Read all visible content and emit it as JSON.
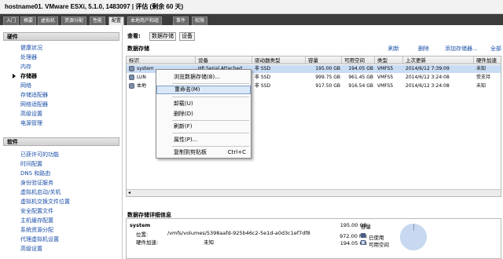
{
  "window": {
    "title": "hostname01. VMware ESXi, 5.1.0, 1483097 | 评估 (剩余 60 天)"
  },
  "tabs": [
    "入门",
    "摘要",
    "虚拟机",
    "资源分配",
    "性能",
    "配置",
    "本地用户和组",
    "事件",
    "权限"
  ],
  "active_tab_index": 5,
  "hardware": {
    "title": "硬件",
    "items": [
      "健康状况",
      "处理器",
      "内存",
      "存储器",
      "网络",
      "存储适配器",
      "网络适配器",
      "高级设置",
      "电源管理"
    ],
    "active_index": 3
  },
  "software": {
    "title": "软件",
    "items": [
      "已获许可的功能",
      "时间配置",
      "DNS 和路由",
      "身份验证服务",
      "虚拟机启动/关机",
      "虚拟机交换文件位置",
      "安全配置文件",
      "主机缓存配置",
      "系统资源分配",
      "代理虚拟机设置",
      "高级设置"
    ]
  },
  "view": {
    "label": "查看:",
    "buttons": [
      "数据存储",
      "设备"
    ]
  },
  "datastores": {
    "title": "数据存储",
    "actions": [
      "刷新",
      "删除",
      "添加存储器...",
      "全部"
    ],
    "columns": [
      "标识",
      "设备",
      "驱动器类型",
      "容量",
      "可用空间",
      "类型",
      "上次更新",
      "硬件加速"
    ],
    "rows": [
      [
        "system",
        "HP Serial Attached",
        "非 SSD",
        "195.00 GB",
        "194.05 GB",
        "VMFS5",
        "2014/6/12 7:39:09",
        "未知"
      ],
      [
        "LUN",
        "",
        "非 SSD",
        "999.75 GB",
        "961.45 GB",
        "VMFS5",
        "2014/6/12 3:24:08",
        "受支持"
      ],
      [
        "本地",
        "",
        "非 SSD",
        "917.50 GB",
        "916.54 GB",
        "VMFS5",
        "2014/6/12 3:24:08",
        "未知"
      ]
    ],
    "selected_row": 0
  },
  "context_menu": {
    "items": [
      "浏览数据存储(B)...",
      "重命名(M)",
      "卸载(U)",
      "删除(D)",
      "刷新(F)",
      "属性(P)...",
      "复制到剪贴板"
    ],
    "shortcut": "Ctrl+C",
    "highlighted_index": 1
  },
  "details": {
    "title": "数据存储详细信息",
    "name": "system",
    "location_label": "位置:",
    "location_value": "/vmfs/volumes/5398aafd-925b46c2-5e1d-a0d3c1ef7df8",
    "hw_accel_label": "硬件加速:",
    "hw_accel_value": "未知",
    "capacity": "195.00 GB",
    "capacity_label": "容量",
    "used": "972.00 MB",
    "used_label": "已使用",
    "free": "194.05 GB",
    "free_label": "可用空间",
    "used_fraction": 0.005
  },
  "colors": {
    "tabbar": "#3c3c3c",
    "link": "#1a4fa8",
    "selection": "#c8dcf4",
    "used": "#4a5e86",
    "free": "#c7d8f0"
  }
}
